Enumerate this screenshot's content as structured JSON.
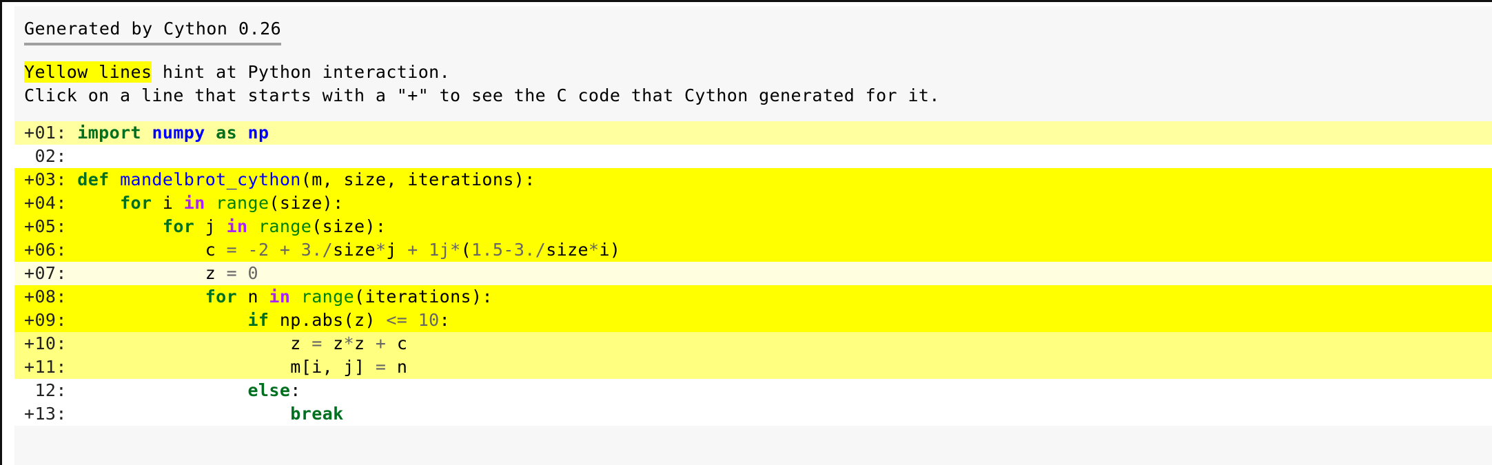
{
  "header": {
    "title": "Generated by Cython 0.26",
    "legend_highlight": "Yellow lines",
    "legend_rest": " hint at Python interaction.",
    "legend_click": "Click on a line that starts with a \"+\" to see the C code that Cython generated for it.",
    "highlight_color": "#ffff00",
    "rule_color": "#a0a0a0"
  },
  "code": {
    "lines": [
      {
        "marker": "+",
        "number": "01",
        "gutter": "+01:",
        "indent": "",
        "score": 1,
        "bg": "#ffff9f",
        "clickable": true,
        "text": "import numpy as np",
        "tokens": [
          {
            "t": "import",
            "c": "t-k"
          },
          {
            "t": " ",
            "c": "t-p"
          },
          {
            "t": "numpy",
            "c": "t-nn"
          },
          {
            "t": " ",
            "c": "t-p"
          },
          {
            "t": "as",
            "c": "t-k"
          },
          {
            "t": " ",
            "c": "t-p"
          },
          {
            "t": "np",
            "c": "t-nn"
          }
        ]
      },
      {
        "marker": " ",
        "number": "02",
        "gutter": " 02:",
        "indent": "",
        "score": 0,
        "bg": "#ffffff",
        "clickable": false,
        "text": "",
        "tokens": []
      },
      {
        "marker": "+",
        "number": "03",
        "gutter": "+03:",
        "indent": "",
        "score": 8,
        "bg": "#ffff00",
        "clickable": true,
        "text": "def mandelbrot_cython(m, size, iterations):",
        "tokens": [
          {
            "t": "def",
            "c": "t-k"
          },
          {
            "t": " ",
            "c": "t-p"
          },
          {
            "t": "mandelbrot_cython",
            "c": "t-nf"
          },
          {
            "t": "(m, size, iterations):",
            "c": "t-p"
          }
        ]
      },
      {
        "marker": "+",
        "number": "04",
        "gutter": "+04:",
        "indent": "    ",
        "score": 8,
        "bg": "#ffff00",
        "clickable": true,
        "text": "    for i in range(size):",
        "tokens": [
          {
            "t": "for",
            "c": "t-k"
          },
          {
            "t": " i ",
            "c": "t-n"
          },
          {
            "t": "in",
            "c": "t-kw2"
          },
          {
            "t": " ",
            "c": "t-p"
          },
          {
            "t": "range",
            "c": "t-nb"
          },
          {
            "t": "(size):",
            "c": "t-p"
          }
        ]
      },
      {
        "marker": "+",
        "number": "05",
        "gutter": "+05:",
        "indent": "        ",
        "score": 8,
        "bg": "#ffff00",
        "clickable": true,
        "text": "        for j in range(size):",
        "tokens": [
          {
            "t": "for",
            "c": "t-k"
          },
          {
            "t": " j ",
            "c": "t-n"
          },
          {
            "t": "in",
            "c": "t-kw2"
          },
          {
            "t": " ",
            "c": "t-p"
          },
          {
            "t": "range",
            "c": "t-nb"
          },
          {
            "t": "(size):",
            "c": "t-p"
          }
        ]
      },
      {
        "marker": "+",
        "number": "06",
        "gutter": "+06:",
        "indent": "            ",
        "score": 8,
        "bg": "#ffff00",
        "clickable": true,
        "text": "            c = -2 + 3./size*j + 1j*(1.5-3./size*i)",
        "tokens": [
          {
            "t": "c ",
            "c": "t-n"
          },
          {
            "t": "= ",
            "c": "t-o"
          },
          {
            "t": "-",
            "c": "t-o"
          },
          {
            "t": "2",
            "c": "t-mi"
          },
          {
            "t": " + ",
            "c": "t-o"
          },
          {
            "t": "3.",
            "c": "t-mi"
          },
          {
            "t": "/",
            "c": "t-o"
          },
          {
            "t": "size",
            "c": "t-n"
          },
          {
            "t": "*",
            "c": "t-o"
          },
          {
            "t": "j",
            "c": "t-n"
          },
          {
            "t": " + ",
            "c": "t-o"
          },
          {
            "t": "1j",
            "c": "t-mi"
          },
          {
            "t": "*",
            "c": "t-o"
          },
          {
            "t": "(",
            "c": "t-p"
          },
          {
            "t": "1.5",
            "c": "t-mi"
          },
          {
            "t": "-",
            "c": "t-o"
          },
          {
            "t": "3.",
            "c": "t-mi"
          },
          {
            "t": "/",
            "c": "t-o"
          },
          {
            "t": "size",
            "c": "t-n"
          },
          {
            "t": "*",
            "c": "t-o"
          },
          {
            "t": "i",
            "c": "t-n"
          },
          {
            "t": ")",
            "c": "t-p"
          }
        ]
      },
      {
        "marker": "+",
        "number": "07",
        "gutter": "+07:",
        "indent": "            ",
        "score": 1,
        "bg": "#ffffe0",
        "clickable": true,
        "text": "            z = 0",
        "tokens": [
          {
            "t": "z ",
            "c": "t-n"
          },
          {
            "t": "= ",
            "c": "t-o"
          },
          {
            "t": "0",
            "c": "t-mi"
          }
        ]
      },
      {
        "marker": "+",
        "number": "08",
        "gutter": "+08:",
        "indent": "            ",
        "score": 8,
        "bg": "#ffff00",
        "clickable": true,
        "text": "            for n in range(iterations):",
        "tokens": [
          {
            "t": "for",
            "c": "t-k"
          },
          {
            "t": " n ",
            "c": "t-n"
          },
          {
            "t": "in",
            "c": "t-kw2"
          },
          {
            "t": " ",
            "c": "t-p"
          },
          {
            "t": "range",
            "c": "t-nb"
          },
          {
            "t": "(iterations):",
            "c": "t-p"
          }
        ]
      },
      {
        "marker": "+",
        "number": "09",
        "gutter": "+09:",
        "indent": "                ",
        "score": 8,
        "bg": "#ffff00",
        "clickable": true,
        "text": "                if np.abs(z) <= 10:",
        "tokens": [
          {
            "t": "if",
            "c": "t-k"
          },
          {
            "t": " np.abs(z) ",
            "c": "t-n"
          },
          {
            "t": "<=",
            "c": "t-o"
          },
          {
            "t": " ",
            "c": "t-p"
          },
          {
            "t": "10",
            "c": "t-mi"
          },
          {
            "t": ":",
            "c": "t-p"
          }
        ]
      },
      {
        "marker": "+",
        "number": "10",
        "gutter": "+10:",
        "indent": "                    ",
        "score": 3,
        "bg": "#ffff80",
        "clickable": true,
        "text": "                    z = z*z + c",
        "tokens": [
          {
            "t": "z ",
            "c": "t-n"
          },
          {
            "t": "= ",
            "c": "t-o"
          },
          {
            "t": "z",
            "c": "t-n"
          },
          {
            "t": "*",
            "c": "t-o"
          },
          {
            "t": "z",
            "c": "t-n"
          },
          {
            "t": " + ",
            "c": "t-o"
          },
          {
            "t": "c",
            "c": "t-n"
          }
        ]
      },
      {
        "marker": "+",
        "number": "11",
        "gutter": "+11:",
        "indent": "                    ",
        "score": 3,
        "bg": "#ffff80",
        "clickable": true,
        "text": "                    m[i, j] = n",
        "tokens": [
          {
            "t": "m[i, j] ",
            "c": "t-n"
          },
          {
            "t": "= ",
            "c": "t-o"
          },
          {
            "t": "n",
            "c": "t-n"
          }
        ]
      },
      {
        "marker": " ",
        "number": "12",
        "gutter": " 12:",
        "indent": "                ",
        "score": 0,
        "bg": "#ffffff",
        "clickable": false,
        "text": "                else:",
        "tokens": [
          {
            "t": "else",
            "c": "t-k"
          },
          {
            "t": ":",
            "c": "t-p"
          }
        ]
      },
      {
        "marker": "+",
        "number": "13",
        "gutter": "+13:",
        "indent": "                    ",
        "score": 0,
        "bg": "#ffffff",
        "clickable": true,
        "text": "                    break",
        "tokens": [
          {
            "t": "break",
            "c": "t-k"
          }
        ]
      }
    ]
  }
}
